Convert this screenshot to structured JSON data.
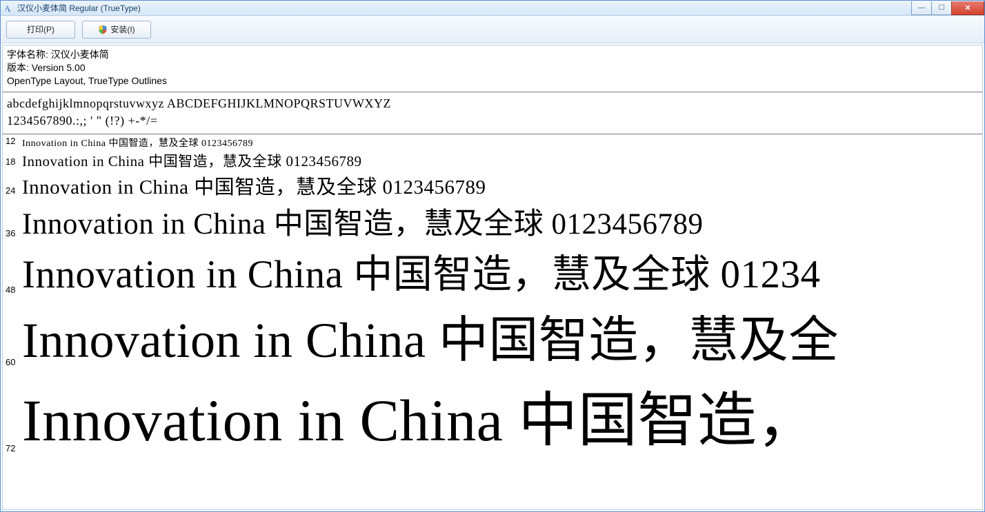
{
  "window": {
    "title": "汉仪小麦体简 Regular (TrueType)"
  },
  "toolbar": {
    "print_label": "打印(P)",
    "install_label": "安装(I)"
  },
  "meta": {
    "font_name_label": "字体名称: ",
    "font_name": "汉仪小麦体简",
    "version_label": "版本: ",
    "version": "Version 5.00",
    "layout_info": "OpenType Layout, TrueType Outlines"
  },
  "glyphset": {
    "line1": "abcdefghijklmnopqrstuvwxyz ABCDEFGHIJKLMNOPQRSTUVWXYZ",
    "line2": "1234567890.:,; ' \" (!?) +-*/="
  },
  "sample_text": "Innovation in China 中国智造，慧及全球 0123456789",
  "sizes": [
    "12",
    "18",
    "24",
    "36",
    "48",
    "60",
    "72"
  ],
  "samples": {
    "s12": "Innovation in China 中国智造，慧及全球 0123456789",
    "s18": "Innovation in China 中国智造，慧及全球 0123456789",
    "s24": "Innovation in China 中国智造，慧及全球 0123456789",
    "s36": "Innovation in China 中国智造，慧及全球 0123456789",
    "s48": "Innovation in China 中国智造，慧及全球 01234",
    "s60": "Innovation in China 中国智造，慧及全",
    "s72": "Innovation in China 中国智造，"
  }
}
